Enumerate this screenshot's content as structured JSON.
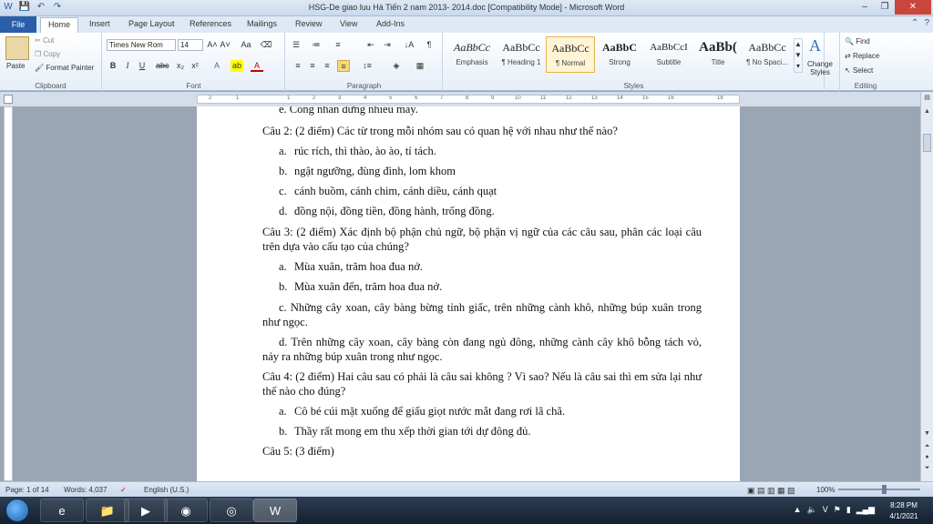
{
  "window": {
    "title": "HSG-De giao luu Hà Tiến 2 nam 2013- 2014.doc [Compatibility Mode] - Microsoft Word",
    "quick_access": [
      "W",
      "💾",
      "↶",
      "↷"
    ]
  },
  "tabs": {
    "file": "File",
    "items": [
      "Home",
      "Insert",
      "Page Layout",
      "References",
      "Mailings",
      "Review",
      "View",
      "Add-Ins"
    ]
  },
  "ribbon": {
    "clipboard": {
      "label": "Clipboard",
      "paste": "Paste",
      "cut": "Cut",
      "copy": "Copy",
      "format_painter": "Format Painter"
    },
    "font": {
      "label": "Font",
      "font_name": "Times New Rom",
      "font_size": "14"
    },
    "paragraph": {
      "label": "Paragraph"
    },
    "styles": {
      "label": "Styles",
      "items": [
        {
          "sample": "AaBbCc",
          "name": "Emphasis"
        },
        {
          "sample": "AaBbCc",
          "name": "¶ Heading 1"
        },
        {
          "sample": "AaBbCc",
          "name": "¶ Normal"
        },
        {
          "sample": "AaBbC",
          "name": "Strong"
        },
        {
          "sample": "AaBbCcI",
          "name": "Subtitle"
        },
        {
          "sample": "AaBb(",
          "name": "Title"
        },
        {
          "sample": "AaBbCc",
          "name": "¶ No Spaci..."
        }
      ],
      "change_styles": "Change Styles"
    },
    "editing": {
      "label": "Editing",
      "find": "Find",
      "replace": "Replace",
      "select": "Select"
    }
  },
  "ruler": {
    "numbers": [
      "2",
      "1",
      "1",
      "2",
      "3",
      "4",
      "5",
      "6",
      "7",
      "8",
      "9",
      "10",
      "11",
      "12",
      "13",
      "14",
      "15",
      "16",
      "18"
    ]
  },
  "document": {
    "top_partial": "e.  Công nhân đứng nhiều máy.",
    "q2": "Câu 2: (2 điểm) Các từ trong mỗi nhóm sau có quan hệ với nhau như thế nào?",
    "q2_items": [
      {
        "label": "a.",
        "text": "rúc rích, thì thào, ào ào, tí tách."
      },
      {
        "label": "b.",
        "text": "ngật ngưỡng, đùng đình, lom khom"
      },
      {
        "label": "c.",
        "text": "cánh buồm, cánh chim, cánh diều, cánh quạt"
      },
      {
        "label": "d.",
        "text": "đồng nội, đồng tiền, đồng hành, trống đồng."
      }
    ],
    "q3": "Câu 3: (2 điểm)     Xác định bộ phận chủ ngữ, bộ phận vị ngữ của các câu sau, phân các loại câu trên dựa vào cấu tạo của chúng?",
    "q3_items": [
      {
        "label": "a.",
        "text": "Mùa xuân, trăm hoa đua nở."
      },
      {
        "label": "b.",
        "text": "Mùa xuân đến, trăm hoa đua nở."
      }
    ],
    "q3_c": "c.  Những cây xoan, cây bàng bừng tỉnh giấc, trên những cành khô, những búp xuân trong như ngọc.",
    "q3_d": "d.  Trên những cây xoan, cây bàng còn đang ngủ đông, những cành cây khô bỗng tách vỏ, nảy ra những búp xuân trong như ngọc.",
    "q4": "Câu 4: (2 điểm)     Hai câu sau có phải là câu sai không ? Vì sao? Nếu là câu sai thì em sửa lại như thế nào cho đúng?",
    "q4_items": [
      {
        "label": "a.",
        "text": "Cô bé cúi mặt xuống để giấu giọt nước mắt đang rơi lã chã."
      },
      {
        "label": "b.",
        "text": "Thầy rất mong em thu xếp thời gian tới dự đông đủ."
      }
    ],
    "q5": "Câu 5: (3 điểm)"
  },
  "statusbar": {
    "page": "Page: 1 of 14",
    "words": "Words: 4,037",
    "language": "English (U.S.)",
    "zoom": "100%"
  },
  "taskbar": {
    "time": "8:28 PM",
    "date": "4/1/2021"
  }
}
